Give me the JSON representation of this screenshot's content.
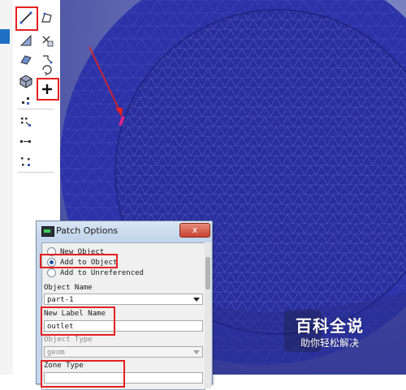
{
  "toolbar": {
    "icons": [
      "edge-tool-icon",
      "vertex-tool-icon",
      "face-select-icon",
      "delete-icon",
      "plane-icon",
      "mirror-icon",
      "cube-icon",
      "rotate-icon",
      "patch-plus-icon",
      "points-icon",
      "nodes-icon",
      "link-icon",
      "scatter-icon"
    ]
  },
  "dialog": {
    "title": "Patch Options",
    "close_label": "x",
    "radio_options": [
      {
        "label": "New Object",
        "selected": false
      },
      {
        "label": "Add to Object",
        "selected": true
      },
      {
        "label": "Add to Unreferenced",
        "selected": false
      }
    ],
    "object_name_label": "Object Name",
    "object_name_value": "part-1",
    "new_label_name_label": "New Label Name",
    "new_label_name_value": "outlet",
    "object_type_label": "Object Type",
    "object_type_value": "geom",
    "zone_type_label": "Zone Type"
  },
  "watermark": {
    "title": "百科全说",
    "subtitle": "助你轻松解决"
  },
  "colors": {
    "mesh": "#2a2f9e",
    "highlight": "#e52020",
    "marker": "#d6268f"
  }
}
